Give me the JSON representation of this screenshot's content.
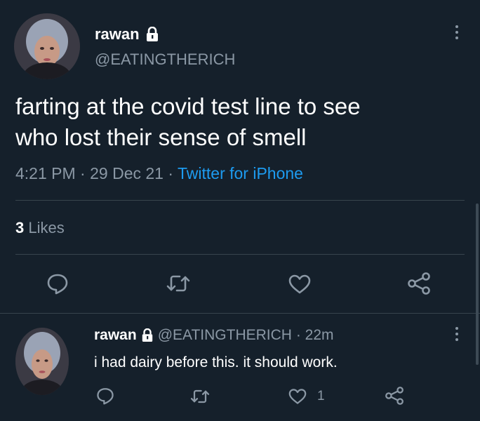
{
  "tweet": {
    "author_name": "rawan",
    "handle": "@EATINGTHERICH",
    "text_line1": "farting at the covid test line to see",
    "text_line2": "who  lost their sense of smell",
    "time": "4:21 PM",
    "sep1": " · ",
    "date": "29 Dec 21",
    "sep2": " · ",
    "source": "Twitter for iPhone",
    "likes_count": "3",
    "likes_label": "Likes"
  },
  "reply": {
    "author_name": "rawan",
    "handle": "@EATINGTHERICH",
    "sep": " · ",
    "age": "22m",
    "text": "i had dairy before this. it should work.",
    "like_count": "1"
  },
  "colors": {
    "background": "#15202b",
    "text_primary": "#ffffff",
    "text_secondary": "#8b98a5",
    "link": "#1d9bf0",
    "divider": "#38444d"
  },
  "icons": [
    "lock-icon",
    "more-icon",
    "reply-icon",
    "retweet-icon",
    "like-icon",
    "share-icon"
  ]
}
